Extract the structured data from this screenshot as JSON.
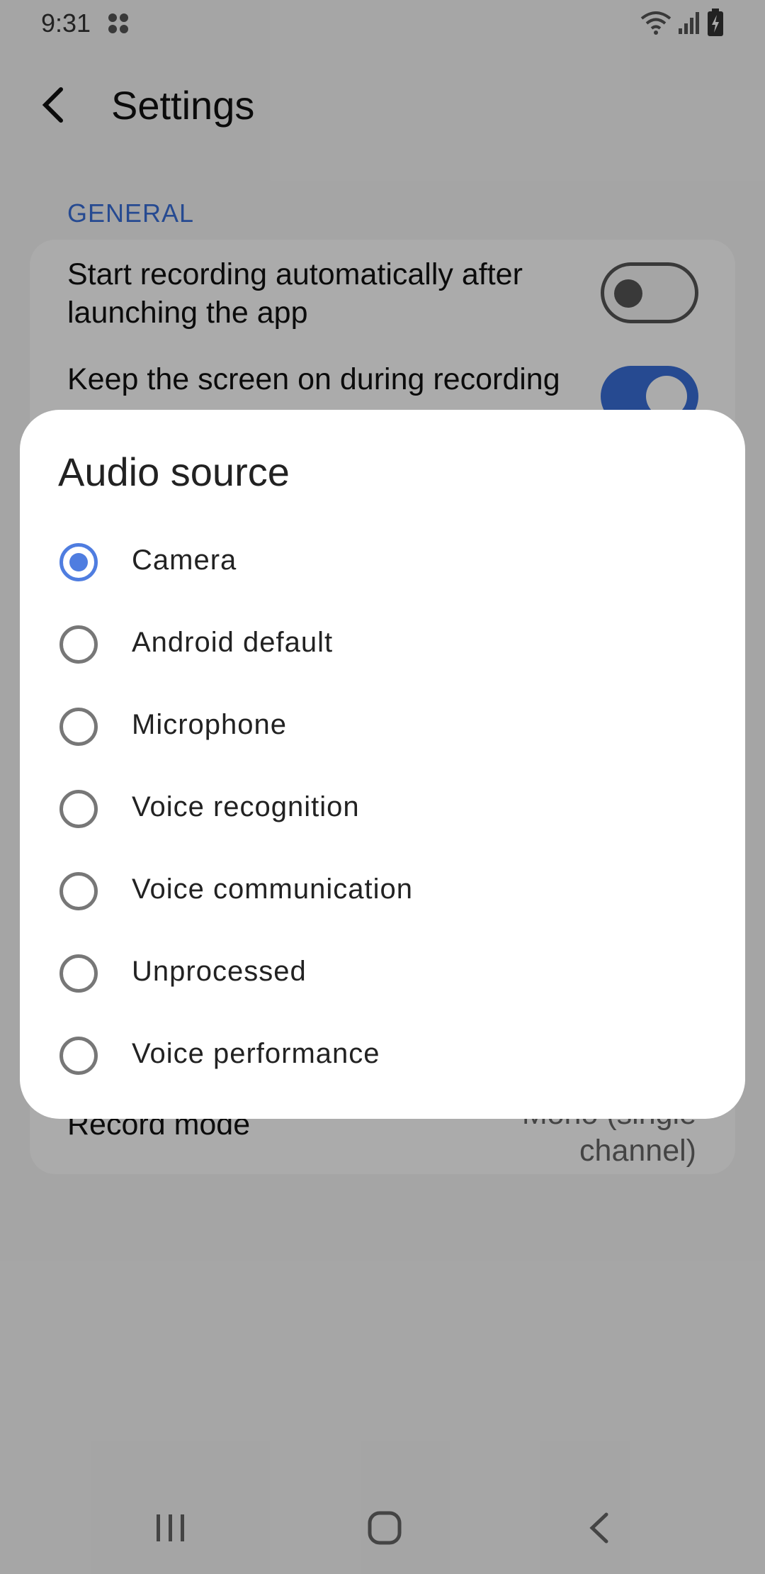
{
  "status_bar": {
    "time": "9:31"
  },
  "app_bar": {
    "title": "Settings"
  },
  "settings": {
    "section_general": "GENERAL",
    "auto_record": {
      "label": "Start recording automatically after launching the app",
      "enabled": false
    },
    "keep_screen_on": {
      "label": "Keep the screen on during recording",
      "enabled": true
    },
    "record_mode": {
      "label": "Record mode",
      "value": "Mono (single channel)"
    }
  },
  "dialog": {
    "title": "Audio source",
    "selected": "Camera",
    "options": [
      {
        "label": "Camera",
        "checked": true
      },
      {
        "label": "Android default",
        "checked": false
      },
      {
        "label": "Microphone",
        "checked": false
      },
      {
        "label": "Voice recognition",
        "checked": false
      },
      {
        "label": "Voice communication",
        "checked": false
      },
      {
        "label": "Unprocessed",
        "checked": false
      },
      {
        "label": "Voice performance",
        "checked": false
      }
    ]
  },
  "colors": {
    "accent": "#3a6fd8",
    "radio_checked": "#4f7de0"
  },
  "icons": [
    "back-arrow-icon",
    "recents-icon",
    "home-icon",
    "nav-back-icon",
    "wifi-icon",
    "signal-icon",
    "battery-charging-icon",
    "notification-icon"
  ]
}
